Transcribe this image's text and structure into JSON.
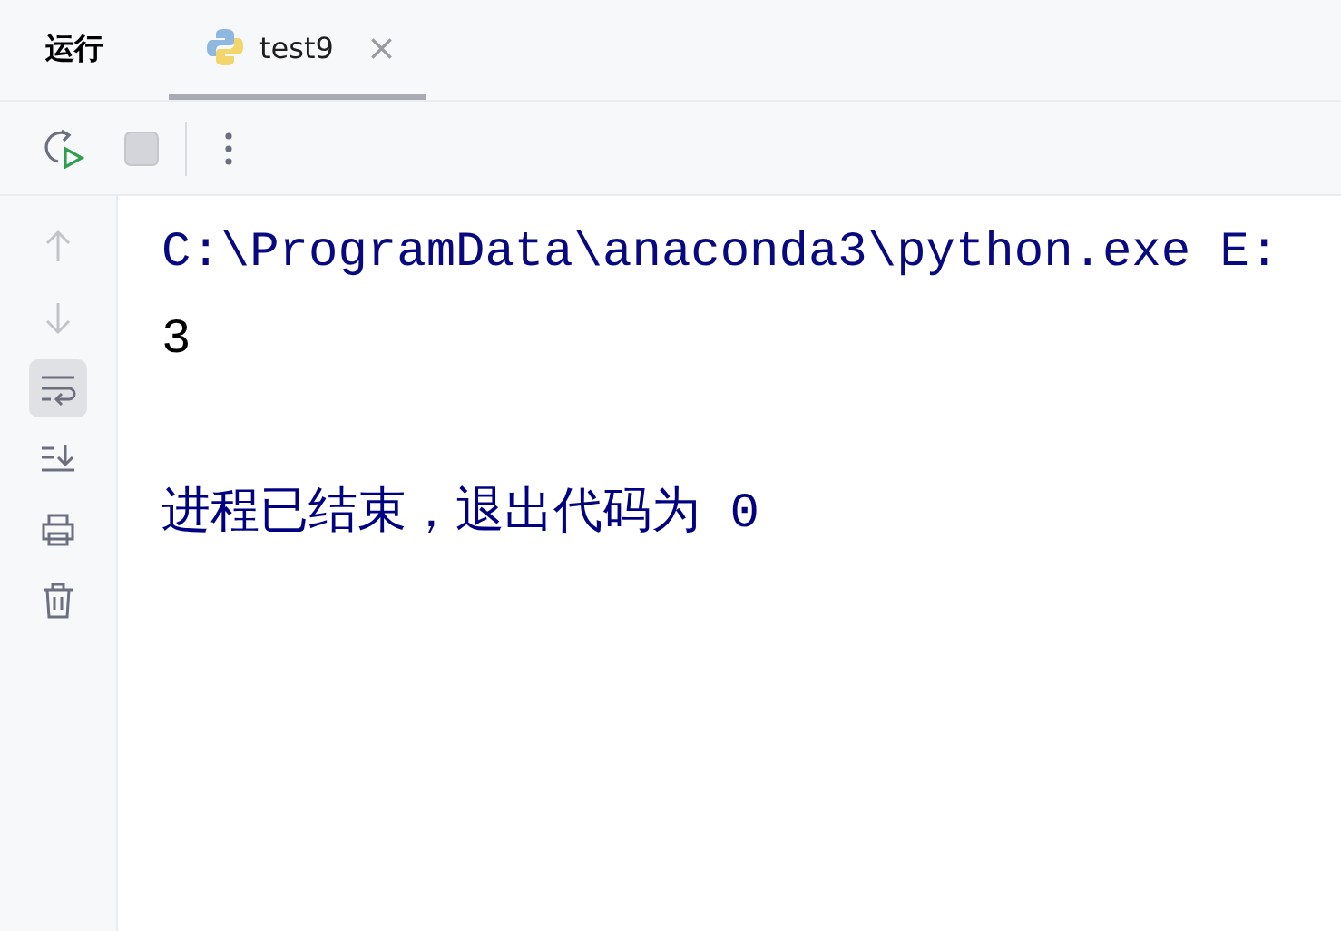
{
  "header": {
    "title": "运行",
    "tabs": [
      {
        "label": "test9",
        "selected": true,
        "close": "×"
      }
    ]
  },
  "toolbar": {
    "tools": [
      {
        "kind": "rerun",
        "disabled": false
      },
      {
        "kind": "stop",
        "disabled": true
      },
      {
        "kind": "more",
        "disabled": false
      }
    ]
  },
  "sidebar": {
    "tools": [
      {
        "kind": "up",
        "disabled": true,
        "selected": false
      },
      {
        "kind": "down",
        "disabled": true,
        "selected": false
      },
      {
        "kind": "wrap",
        "disabled": false,
        "selected": true
      },
      {
        "kind": "scroll-end",
        "disabled": false,
        "selected": false
      },
      {
        "kind": "print",
        "disabled": false,
        "selected": false
      },
      {
        "kind": "trash",
        "disabled": false,
        "selected": false
      }
    ]
  },
  "console": {
    "lines": [
      {
        "kind": "command",
        "text": "C:\\ProgramData\\anaconda3\\python.exe E:"
      },
      {
        "kind": "output",
        "text": "3"
      },
      {
        "kind": "blank"
      },
      {
        "kind": "system",
        "text": "进程已结束，退出代码为 0"
      }
    ]
  }
}
